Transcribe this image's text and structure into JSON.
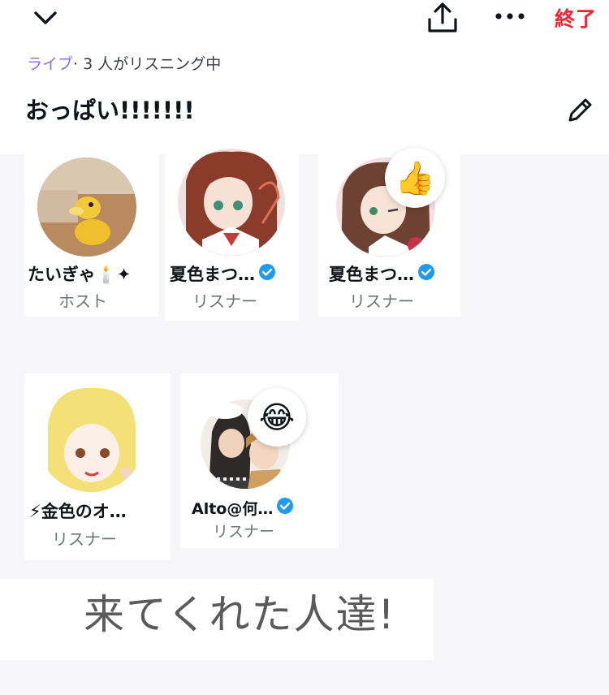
{
  "header": {
    "end_label": "終了",
    "icons": [
      "chevron-down-icon",
      "share-icon",
      "more-icon"
    ]
  },
  "space": {
    "live_label": "ライブ",
    "listening_text": "· 3 人がリスニング中",
    "title": "おっぱい!!!!!!!",
    "edit_icon": "pencil-icon"
  },
  "participants": [
    {
      "name": "たいぎゃ🕯️✦",
      "role": "ホスト",
      "verified": false,
      "reaction": ""
    },
    {
      "name": "夏色まつ…",
      "role": "リスナー",
      "verified": true,
      "reaction": ""
    },
    {
      "name": "夏色まつ…",
      "role": "リスナー",
      "verified": true,
      "reaction": "👍"
    },
    {
      "name": "⚡金色のオ…",
      "role": "リスナー",
      "verified": false,
      "reaction": ""
    },
    {
      "name": "Alto@何…",
      "role": "リスナー",
      "verified": true,
      "reaction": "😂"
    }
  ],
  "caption": "来てくれた人達!",
  "colors": {
    "accent_live": "#8a6cf0",
    "end": "#f4212e",
    "verified": "#1d9bf0"
  }
}
